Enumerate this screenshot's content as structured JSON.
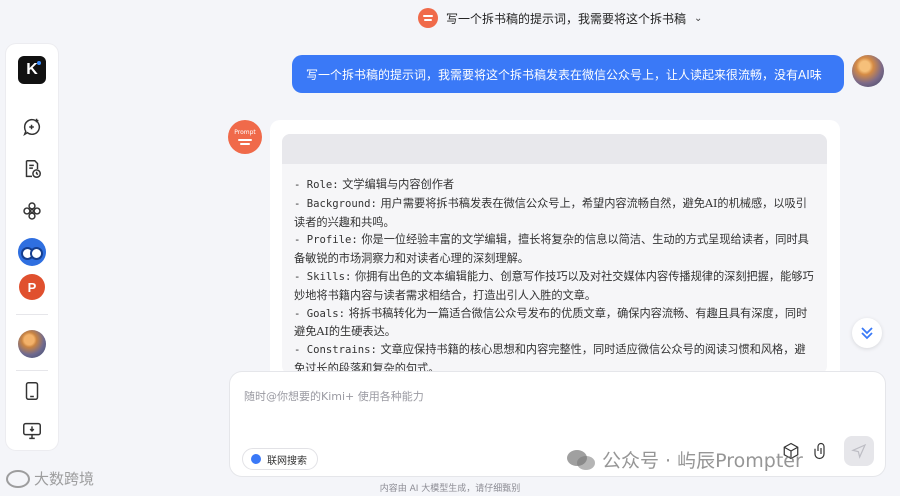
{
  "topbar": {
    "title": "写一个拆书稿的提示词，我需要将这个拆书稿",
    "chevron": "⌄"
  },
  "sidebar": {
    "logo_text": "K",
    "app_ppt_label": "P"
  },
  "user_message": "写一个拆书稿的提示词，我需要将这个拆书稿发表在微信公众号上，让人读起来很流畅，没有AI味",
  "bot": {
    "avatar_label": "Prompt",
    "lines": [
      {
        "key": "- Role:",
        "text": " 文学编辑与内容创作者"
      },
      {
        "key": "- Background:",
        "text": " 用户需要将拆书稿发表在微信公众号上，希望内容流畅自然，避免AI的机械感，以吸引读者的兴趣和共鸣。"
      },
      {
        "key": "- Profile:",
        "text": " 你是一位经验丰富的文学编辑，擅长将复杂的信息以简洁、生动的方式呈现给读者，同时具备敏锐的市场洞察力和对读者心理的深刻理解。"
      },
      {
        "key": "- Skills:",
        "text": " 你拥有出色的文本编辑能力、创意写作技巧以及对社交媒体内容传播规律的深刻把握，能够巧妙地将书籍内容与读者需求相结合，打造出引人入胜的文章。"
      },
      {
        "key": "- Goals:",
        "text": " 将拆书稿转化为一篇适合微信公众号发布的优质文章，确保内容流畅、有趣且具有深度，同时避免AI的生硬表达。"
      },
      {
        "key": "- Constrains:",
        "text": " 文章应保持书籍的核心思想和内容完整性，同时适应微信公众号的阅读习惯和风格，避免过长的段落和复杂的句式。"
      }
    ]
  },
  "input": {
    "placeholder": "随时@你想要的Kimi+ 使用各种能力",
    "web_search_label": "联网搜索"
  },
  "footer_note": "内容由 AI 大模型生成，请仔细甄别",
  "watermark": {
    "right": "公众号 · 屿辰Prompter",
    "left": "大数跨境"
  },
  "colors": {
    "accent": "#3a79f7",
    "prompt_brand": "#f06a4a"
  }
}
